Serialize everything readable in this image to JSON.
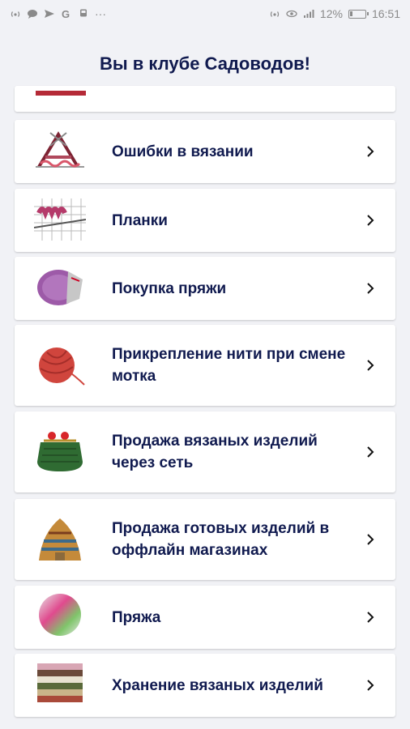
{
  "status_bar": {
    "battery_percent": "12%",
    "time": "16:51",
    "dots": "···"
  },
  "header": {
    "title": "Вы в клубе Садоводов!"
  },
  "items": [
    {
      "label": "Ошибки в вязании",
      "icon": "knitting-mistake-icon"
    },
    {
      "label": "Планки",
      "icon": "knit-border-icon"
    },
    {
      "label": "Покупка пряжи",
      "icon": "purple-yarn-skein-icon"
    },
    {
      "label": "Прикрепление нити при смене мотка",
      "icon": "red-yarn-ball-icon"
    },
    {
      "label": "Продажа вязаных изделий через сеть",
      "icon": "green-purse-icon"
    },
    {
      "label": "Продажа готовых изделий в оффлайн магазинах",
      "icon": "knitted-hat-icon"
    },
    {
      "label": "Пряжа",
      "icon": "multicolor-yarn-icon"
    },
    {
      "label": "Хранение вязаных изделий",
      "icon": "folded-sweaters-icon"
    }
  ],
  "colors": {
    "background": "#f1f2f6",
    "text": "#101a4f",
    "card": "#ffffff"
  }
}
